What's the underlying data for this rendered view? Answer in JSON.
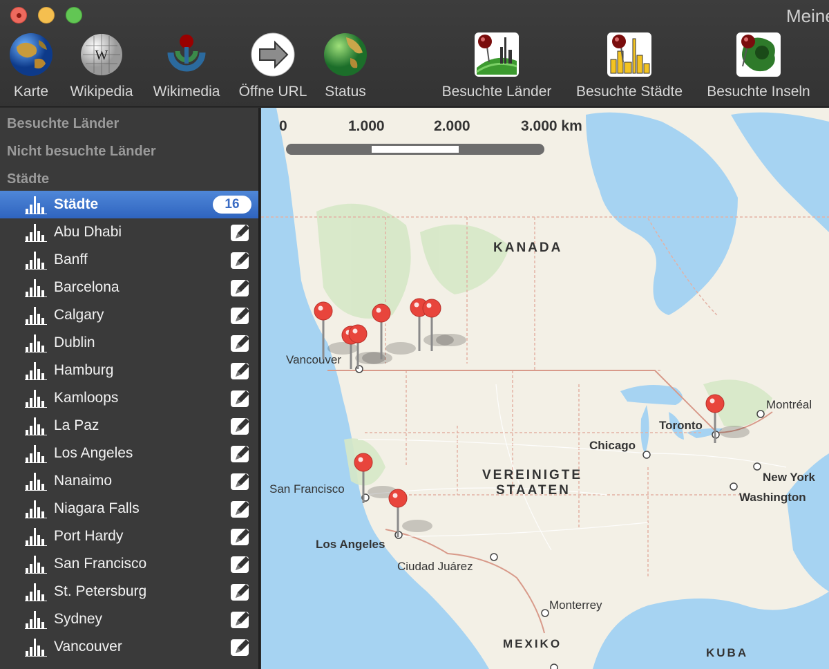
{
  "window": {
    "title": "Meine"
  },
  "toolbar": {
    "items": [
      {
        "label": "Karte",
        "icon": "globe-icon"
      },
      {
        "label": "Wikipedia",
        "icon": "wikipedia-globe-icon"
      },
      {
        "label": "Wikimedia",
        "icon": "wikimedia-icon"
      },
      {
        "label": "Öffne URL",
        "icon": "arrow-right-icon"
      },
      {
        "label": "Status",
        "icon": "status-globe-icon"
      },
      {
        "label": "Besuchte Länder",
        "icon": "visited-countries-icon"
      },
      {
        "label": "Besuchte Städte",
        "icon": "visited-cities-icon"
      },
      {
        "label": "Besuchte Inseln",
        "icon": "visited-islands-icon"
      }
    ]
  },
  "sidebar": {
    "sections": [
      "Besuchte Länder",
      "Nicht besuchte Länder",
      "Städte"
    ],
    "selected": {
      "label": "Städte",
      "count": "16"
    },
    "cities": [
      "Abu Dhabi",
      "Banff",
      "Barcelona",
      "Calgary",
      "Dublin",
      "Hamburg",
      "Kamloops",
      "La Paz",
      "Los Angeles",
      "Nanaimo",
      "Niagara Falls",
      "Port Hardy",
      "San Francisco",
      "St. Petersburg",
      "Sydney",
      "Vancouver"
    ]
  },
  "map": {
    "scale": {
      "labels": [
        "0",
        "1.000",
        "2.000",
        "3.000 km"
      ]
    },
    "countries": {
      "canada": "KANADA",
      "usa_line1": "VEREINIGTE",
      "usa_line2": "STAATEN",
      "mexico": "MEXIKO",
      "cuba": "KUBA"
    },
    "cities": {
      "vancouver": "Vancouver",
      "montreal": "Montréal",
      "toronto": "Toronto",
      "chicago": "Chicago",
      "new_york": "New York",
      "washington": "Washington",
      "san_francisco": "San Francisco",
      "los_angeles": "Los Angeles",
      "ciudad_juarez": "Ciudad Juárez",
      "monterrey": "Monterrey"
    },
    "pin_color": "#e8453c",
    "water_color": "#a6d3f2",
    "land_color": "#f4f1e8"
  }
}
